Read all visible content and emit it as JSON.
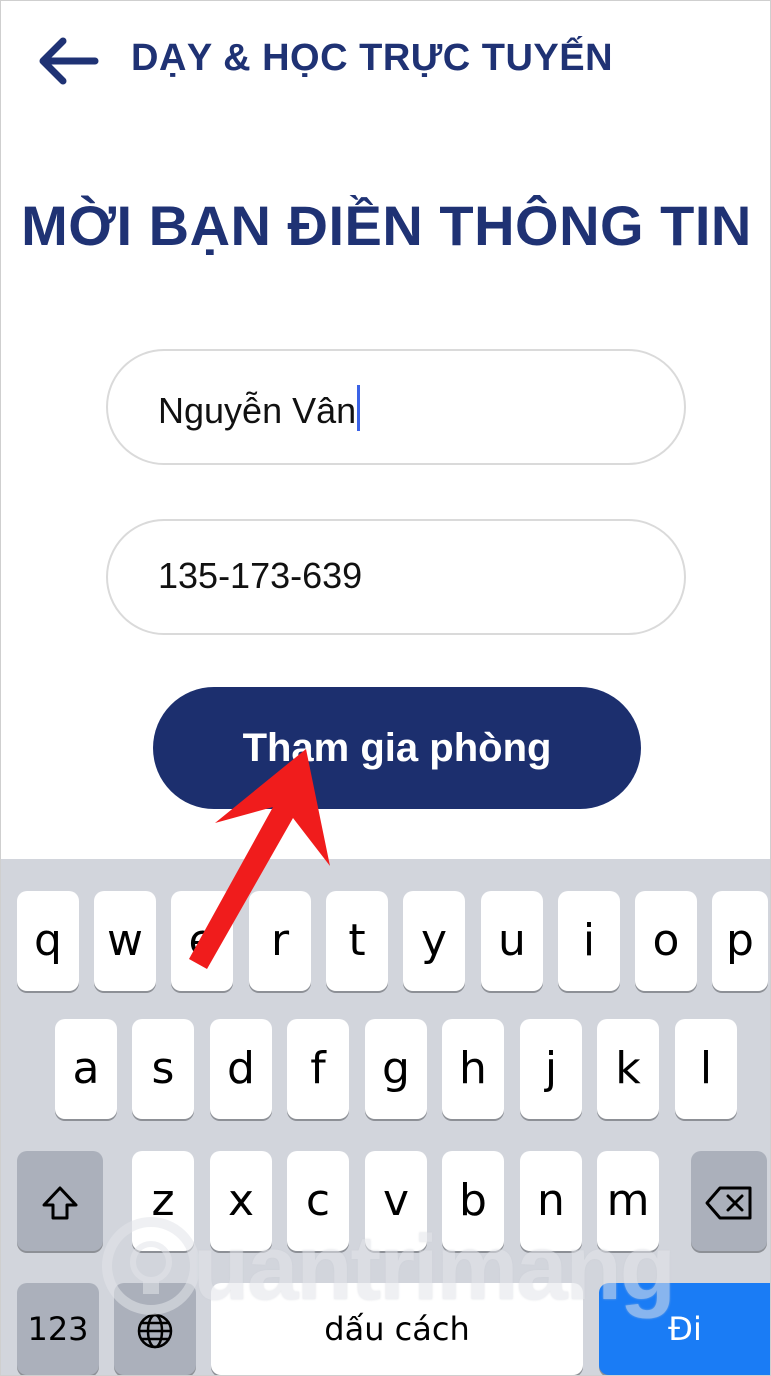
{
  "header": {
    "back_icon": "arrow-left-icon",
    "title": "DẠY & HỌC TRỰC TUYẾN"
  },
  "form": {
    "heading": "MỜI BẠN ĐIỀN THÔNG TIN",
    "name_value": "Nguyễn Vân",
    "code_value": "135-173-639",
    "join_button": "Tham gia phòng"
  },
  "keyboard": {
    "row1": [
      "q",
      "w",
      "e",
      "r",
      "t",
      "y",
      "u",
      "i",
      "o",
      "p"
    ],
    "row2": [
      "a",
      "s",
      "d",
      "f",
      "g",
      "h",
      "j",
      "k",
      "l"
    ],
    "row3": [
      "z",
      "x",
      "c",
      "v",
      "b",
      "n",
      "m"
    ],
    "shift_icon": "shift-icon",
    "backspace_icon": "backspace-icon",
    "numbers_label": "123",
    "globe_icon": "globe-icon",
    "space_label": "dấu cách",
    "go_label": "Đi"
  },
  "annotation": {
    "arrow_color": "#f01c1c"
  },
  "watermark": {
    "text": "uantrimang",
    "logo_icon": "lightbulb-icon"
  },
  "colors": {
    "brand_navy": "#1f3274",
    "button_navy": "#1c2f6e",
    "go_blue": "#1a7cf5"
  }
}
